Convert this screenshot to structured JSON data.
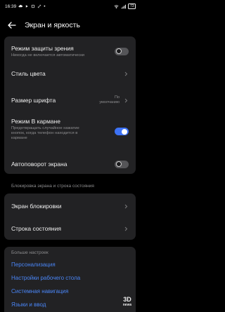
{
  "status_bar": {
    "time": "16:39",
    "battery": "73"
  },
  "header": {
    "title": "Экран и яркость"
  },
  "rows": {
    "eye_protection": {
      "label": "Режим защиты зрения",
      "sub": "Никогда не включается автоматически",
      "state": "off"
    },
    "color_style": {
      "label": "Стиль цвета"
    },
    "font_size": {
      "label": "Размер шрифта",
      "value_line1": "По",
      "value_line2": "умолчанию"
    },
    "pocket_mode": {
      "label": "Режим В кармане",
      "sub_line1": "Предотвращать случайное нажатие",
      "sub_line2": "кнопок, когда телефон находится в",
      "sub_line3": "кармане",
      "state": "on"
    },
    "auto_rotate": {
      "label": "Автоповорот экрана",
      "state": "off"
    }
  },
  "lock_section": {
    "label": "Блокировка экрана и строка состояния",
    "lock_screen": "Экран блокировки",
    "status_bar": "Строка состояния"
  },
  "more": {
    "label": "Больше настроек",
    "links": [
      "Персонализация",
      "Настройки рабочего стола",
      "Системная навигация",
      "Языки и ввод"
    ]
  },
  "watermark": {
    "line1": "3D",
    "line2": "news"
  },
  "colors": {
    "accent": "#3d72f5",
    "link": "#4a86f7",
    "card": "#222224",
    "background": "#000000"
  }
}
